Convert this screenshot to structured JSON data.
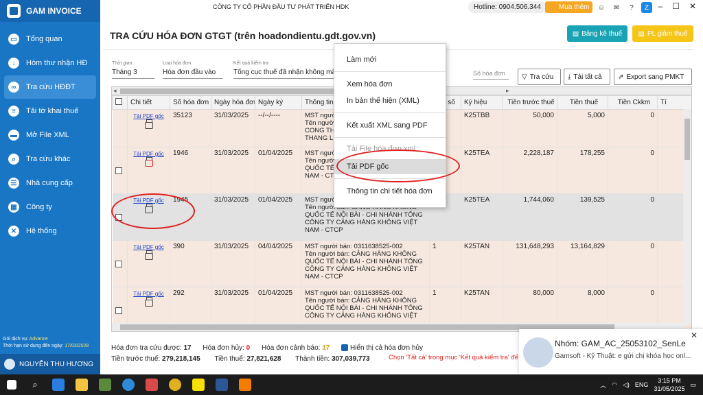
{
  "app": {
    "name": "GAM INVOICE",
    "company": "CÔNG TY CỔ PHẦN ĐẦU TƯ PHÁT TRIỂN HDK"
  },
  "top": {
    "hotline": "Hotline: 0904.506.344",
    "buy": "Mua thêm"
  },
  "sidebar": {
    "items": [
      {
        "label": "Tổng quan",
        "icon": "monitor-icon"
      },
      {
        "label": "Hòm thư nhận HĐ",
        "icon": "download-icon"
      },
      {
        "label": "Tra cứu HĐĐT",
        "icon": "link-icon"
      },
      {
        "label": "Tải tờ khai thuế",
        "icon": "document-icon"
      },
      {
        "label": "Mở File XML",
        "icon": "folder-icon"
      },
      {
        "label": "Tra cứu khác",
        "icon": "search-icon"
      },
      {
        "label": "Nhà cung cấp",
        "icon": "contacts-icon"
      },
      {
        "label": "Công ty",
        "icon": "building-icon"
      },
      {
        "label": "Hệ thống",
        "icon": "tools-icon"
      }
    ],
    "service_label": "Gói dịch vụ:",
    "service_value": "Advance",
    "expiry_label": "Thời hạn sử dụng đến ngày:",
    "expiry_value": "17/03/2028",
    "user": "NGUYỄN THU HƯƠNG"
  },
  "page": {
    "title": "TRA CỨU HÓA ĐƠN GTGT (trên hoadondientu.gdt.gov.vn)",
    "btn_bangke": "Bảng kê thuế",
    "btn_pl": "PL giảm thuế"
  },
  "filters": {
    "period_label": "Thời gian",
    "period": "Tháng 3",
    "type_label": "Loại hóa đơn",
    "type": "Hóa đơn đầu vào",
    "result_label": "Kết quả kiểm tra",
    "result": "Tổng cục thuế đã nhận không mã",
    "invoice_no_placeholder": "Số hóa đơn"
  },
  "actions": {
    "search": "Tra cứu",
    "download_all": "Tải tất cả",
    "export": "Export sang PMKT"
  },
  "table": {
    "headers": [
      "Chi tiết",
      "Số hóa đơn",
      "Ngày hóa đơn",
      "Ngày ký",
      "Thông tin",
      "Mẫu số",
      "Ký hiệu",
      "Tiền trước thuế",
      "Tiền thuế",
      "Tiền Ckkm",
      "Tí"
    ],
    "pdf_link": "Tải PDF gốc",
    "rows": [
      {
        "no": "35123",
        "date": "31/03/2025",
        "sign": "--/--/----",
        "info": "MST người bán: \nTên người bán: \nCONG TH\nTHANG L",
        "form": "",
        "symbol": "K25TBB",
        "before": "50,000",
        "tax": "5,000",
        "ck": "0"
      },
      {
        "no": "1946",
        "date": "31/03/2025",
        "sign": "01/04/2025",
        "info": "MST người bán:\nTên người bán:\nQUỐC TẾ\nNAM - CTCP",
        "form": "",
        "symbol": "K25TEA",
        "before": "2,228,187",
        "tax": "178,255",
        "ck": "0"
      },
      {
        "no": "1945",
        "date": "31/03/2025",
        "sign": "01/04/2025",
        "info": "MST người bán:\nTên người bán: CẢNG HÀNG KHÔNG QUỐC TẾ NỘI BÀI - CHI NHÁNH TỔNG CÔNG TY CẢNG HÀNG KHÔNG VIỆT NAM - CTCP",
        "form": "",
        "symbol": "K25TEA",
        "before": "1,744,060",
        "tax": "139,525",
        "ck": "0"
      },
      {
        "no": "390",
        "date": "31/03/2025",
        "sign": "04/04/2025",
        "info": "MST người bán: 0311638525-002\nTên người bán: CẢNG HÀNG KHÔNG QUỐC TẾ NỘI BÀI - CHI NHÁNH TỔNG CÔNG TY CẢNG HÀNG KHÔNG VIỆT NAM - CTCP",
        "form": "1",
        "symbol": "K25TAN",
        "before": "131,648,293",
        "tax": "13,164,829",
        "ck": "0"
      },
      {
        "no": "292",
        "date": "31/03/2025",
        "sign": "01/04/2025",
        "info": "MST người bán: 0311638525-002\nTên người bán: CẢNG HÀNG KHÔNG QUỐC TẾ NỘI BÀI - CHI NHÁNH TỔNG CÔNG TY CẢNG HÀNG KHÔNG VIỆT",
        "form": "1",
        "symbol": "K25TAN",
        "before": "80,000",
        "tax": "8,000",
        "ck": "0"
      }
    ]
  },
  "context_menu": {
    "items": [
      "Làm mới",
      "Xem hóa đơn",
      "In bản thể hiện (XML)",
      "Kết xuất XML sang PDF",
      "Tải File hóa đơn xml",
      "Tải PDF gốc",
      "Thông tin chi tiết hóa đơn"
    ]
  },
  "summary": {
    "count_label": "Hóa đơn tra cứu được:",
    "count": "17",
    "cancelled_label": "Hóa đơn hủy:",
    "cancelled": "0",
    "warn_label": "Hóa đơn cảnh báo:",
    "warn": "17",
    "show_cancelled": "Hiển thị cả hóa đơn hủy",
    "before_label": "Tiền trước thuế:",
    "before": "279,218,145",
    "tax_label": "Tiền thuế:",
    "tax": "27,821,628",
    "total_label": "Thành tiền:",
    "total": "307,039,773",
    "note": "Chọn 'Tất cả' trong mục 'Kết quả kiểm tra' để"
  },
  "notification": {
    "title": "Nhóm: GAM_AC_25053102_SenLe",
    "body": "Gamsoft - Kỹ Thuật: e gửi chị khóa học onl..."
  },
  "taskbar": {
    "lang": "ENG",
    "time": "3:15 PM",
    "date": "31/05/2025"
  },
  "colors": {
    "sidebar": "#1976c4",
    "accent_teal": "#1aa3b5",
    "accent_yellow": "#f5c518",
    "highlight_red": "#e02020",
    "row_peach": "#f6e8df"
  }
}
